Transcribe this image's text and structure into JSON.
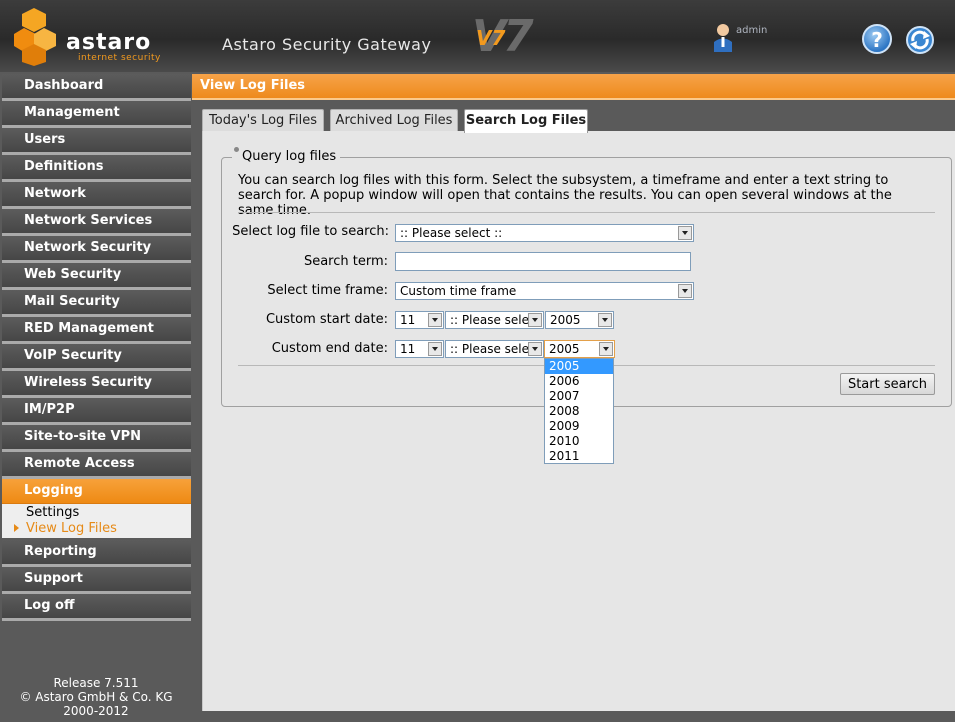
{
  "header": {
    "logo_word": "astaro",
    "logo_tagline": "internet security",
    "product_title": "Astaro Security Gateway",
    "version": "V7",
    "user_name": "admin"
  },
  "sidebar": {
    "items": [
      {
        "label": "Dashboard"
      },
      {
        "label": "Management"
      },
      {
        "label": "Users"
      },
      {
        "label": "Definitions"
      },
      {
        "label": "Network"
      },
      {
        "label": "Network Services"
      },
      {
        "label": "Network Security"
      },
      {
        "label": "Web Security"
      },
      {
        "label": "Mail Security"
      },
      {
        "label": "RED Management"
      },
      {
        "label": "VoIP Security"
      },
      {
        "label": "Wireless Security"
      },
      {
        "label": "IM/P2P"
      },
      {
        "label": "Site-to-site VPN"
      },
      {
        "label": "Remote Access"
      },
      {
        "label": "Logging"
      },
      {
        "label": "Reporting"
      },
      {
        "label": "Support"
      },
      {
        "label": "Log off"
      }
    ],
    "logging_sub": {
      "settings": "Settings",
      "view_log_files": "View Log Files"
    },
    "release": {
      "line1": "Release 7.511",
      "line2": "© Astaro GmbH & Co. KG",
      "line3": "2000-2012"
    }
  },
  "page": {
    "title": "View Log Files",
    "tabs": {
      "today": "Today's Log Files",
      "archived": "Archived Log Files",
      "search": "Search Log Files"
    }
  },
  "form": {
    "legend": "Query log files",
    "intro": "You can search log files with this form. Select the subsystem, a timeframe and enter a text string to search for. A popup window will open that contains the results. You can open several windows at the same time.",
    "log_file_label": "Select log file to search:",
    "log_file_value": ":: Please select ::",
    "search_term_label": "Search term:",
    "search_term_value": "",
    "time_frame_label": "Select time frame:",
    "time_frame_value": "Custom time frame",
    "start_date_label": "Custom start date:",
    "start_day": "11",
    "start_month": ":: Please select ::",
    "start_year": "2005",
    "end_date_label": "Custom end date:",
    "end_day": "11",
    "end_month": ":: Please select ::",
    "end_year": "2005",
    "start_search": "Start search"
  },
  "year_dropdown": {
    "options": [
      "2005",
      "2006",
      "2007",
      "2008",
      "2009",
      "2010",
      "2011"
    ],
    "selected": "2005"
  }
}
